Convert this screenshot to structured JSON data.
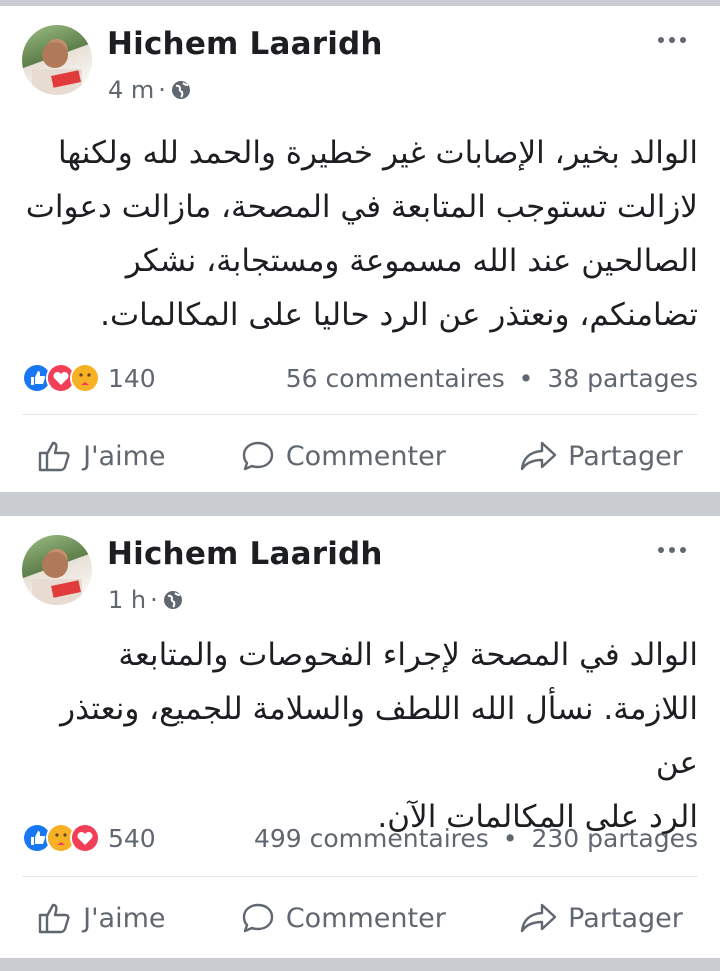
{
  "posts": [
    {
      "author": "Hichem Laaridh",
      "time": "4 m",
      "meta_separator": "·",
      "visibility_icon": "globe-icon",
      "text_lines": [
        "الوالد بخير، الإصابات غير خطيرة والحمد لله ولكنها",
        "لازالت تستوجب المتابعة في المصحة، مازالت دعوات",
        "الصالحين عند الله مسموعة ومستجابة، نشكر",
        "تضامنكم، ونعتذر عن الرد حاليا على المكالمات."
      ],
      "reactions": [
        "like",
        "love",
        "care"
      ],
      "reaction_count": "140",
      "comments": "56 commentaires",
      "dot": "•",
      "shares": "38 partages",
      "actions": {
        "like": "J'aime",
        "comment": "Commenter",
        "share": "Partager"
      }
    },
    {
      "author": "Hichem Laaridh",
      "time": "1 h",
      "meta_separator": "·",
      "visibility_icon": "globe-icon",
      "text_lines": [
        "الوالد في المصحة لإجراء الفحوصات والمتابعة",
        "اللازمة. نسأل الله اللطف والسلامة للجميع، ونعتذر عن",
        "الرد على المكالمات الآن."
      ],
      "reactions": [
        "like",
        "care",
        "love"
      ],
      "reaction_count": "540",
      "comments": "499 commentaires",
      "dot": "•",
      "shares": "230 partages",
      "actions": {
        "like": "J'aime",
        "comment": "Commenter",
        "share": "Partager"
      }
    }
  ],
  "colors": {
    "background": "#c9ccd1",
    "card": "#ffffff",
    "text": "#1c1e21",
    "secondary": "#606770",
    "like_blue": "#1877f2",
    "love_red": "#f33e58",
    "care_yellow": "#f7b125"
  }
}
